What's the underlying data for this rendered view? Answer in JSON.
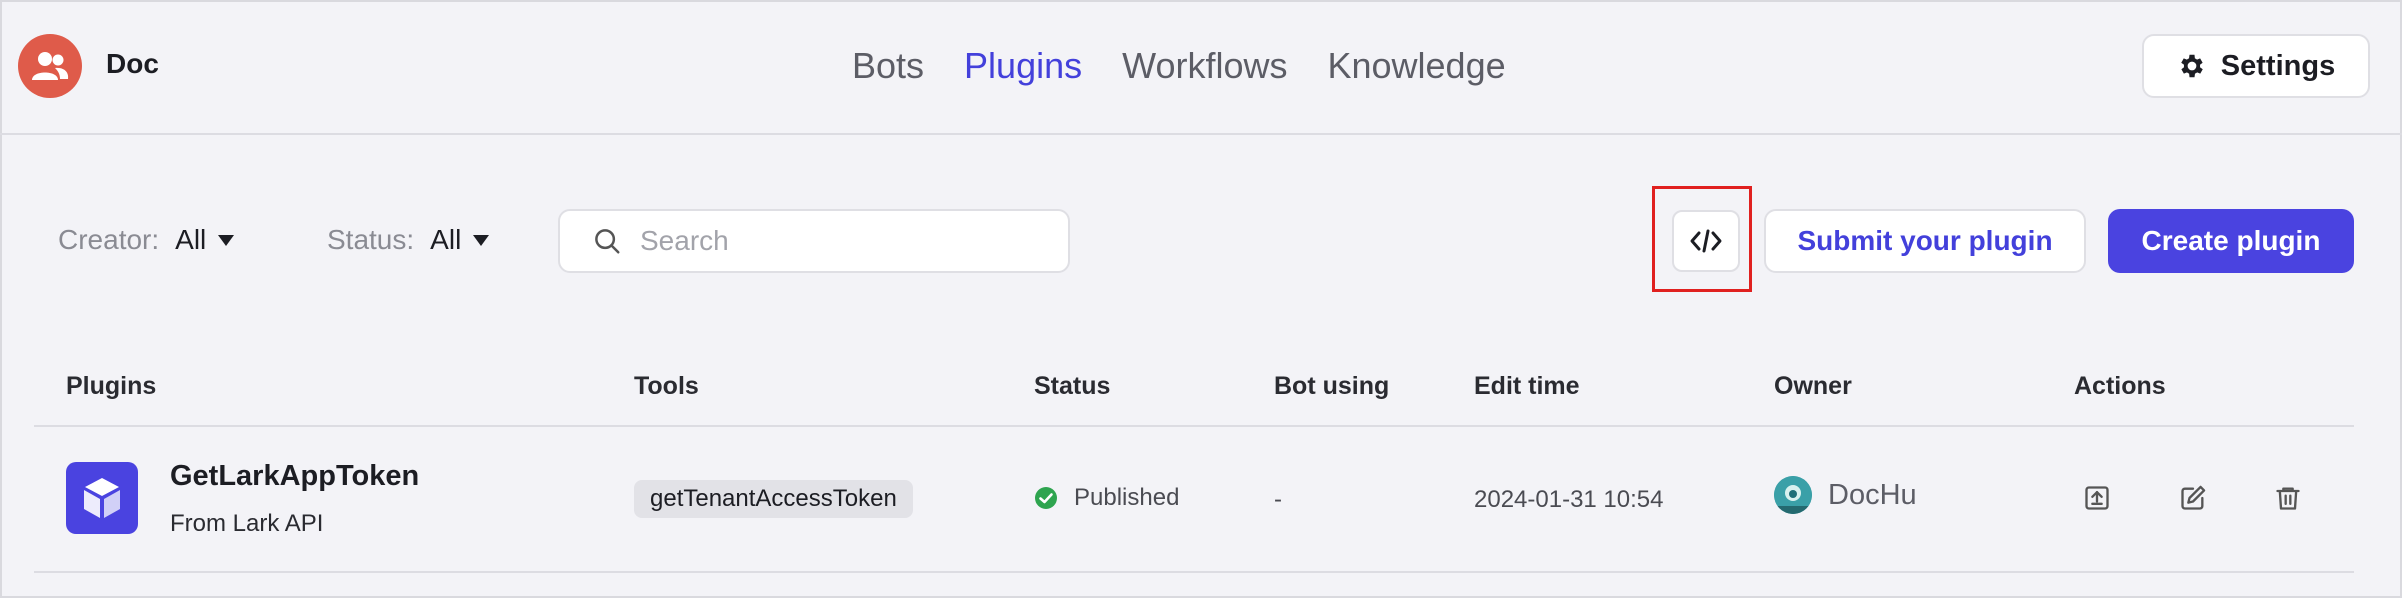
{
  "header": {
    "brand": "Doc",
    "nav": [
      {
        "label": "Bots",
        "active": false
      },
      {
        "label": "Plugins",
        "active": true
      },
      {
        "label": "Workflows",
        "active": false
      },
      {
        "label": "Knowledge",
        "active": false
      }
    ],
    "settings_label": "Settings"
  },
  "toolbar": {
    "creator_label": "Creator:",
    "creator_value": "All",
    "status_label": "Status:",
    "status_value": "All",
    "search_placeholder": "Search",
    "search_value": "",
    "code_icon": "code-icon",
    "submit_label": "Submit your plugin",
    "create_label": "Create plugin"
  },
  "table": {
    "columns": [
      "Plugins",
      "Tools",
      "Status",
      "Bot using",
      "Edit time",
      "Owner",
      "Actions"
    ],
    "rows": [
      {
        "name": "GetLarkAppToken",
        "source": "From Lark API",
        "tool": "getTenantAccessToken",
        "status": "Published",
        "bot_using": "-",
        "edit_time": "2024-01-31 10:54",
        "owner": "DocHu",
        "actions": [
          "publish-icon",
          "edit-icon",
          "delete-icon"
        ]
      }
    ]
  },
  "colors": {
    "accent": "#4340db",
    "primary_button": "#4a43e0",
    "avatar": "#df5b4a",
    "published": "#2ea44f",
    "highlight": "#e0201f"
  }
}
